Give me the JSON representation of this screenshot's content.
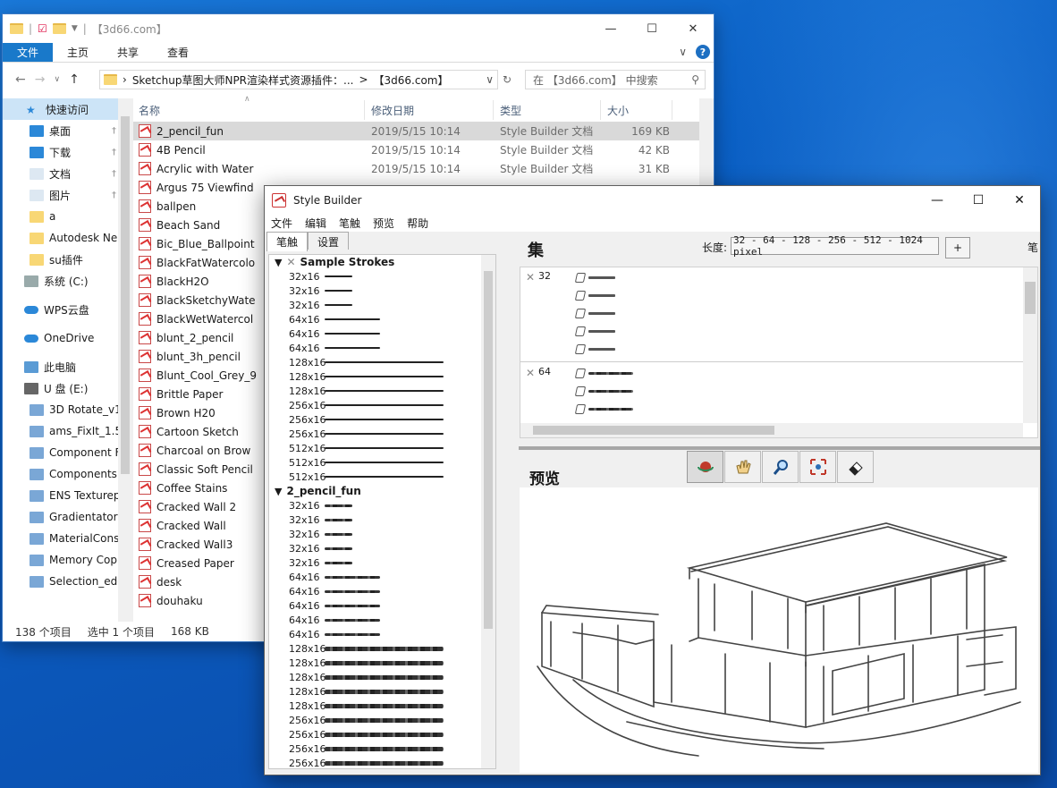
{
  "explorer": {
    "title": "【3d66.com】",
    "ribbon_tabs": [
      "文件",
      "主页",
      "共享",
      "查看"
    ],
    "address": {
      "path1": "Sketchup草图大师NPR渲染样式资源插件：...",
      "sep": ">",
      "path2": "【3d66.com】"
    },
    "search_placeholder": "在 【3d66.com】 中搜索",
    "nav": [
      {
        "label": "快速访问",
        "icon": "star-icon"
      },
      {
        "label": "桌面",
        "icon": "desktop-icon",
        "pinned": true
      },
      {
        "label": "下载",
        "icon": "download-icon",
        "pinned": true
      },
      {
        "label": "文档",
        "icon": "document-icon",
        "pinned": true
      },
      {
        "label": "图片",
        "icon": "pictures-icon",
        "pinned": true
      },
      {
        "label": "a",
        "icon": "folder-icon"
      },
      {
        "label": "Autodesk Ne",
        "icon": "folder-icon"
      },
      {
        "label": "su插件",
        "icon": "folder-icon"
      },
      {
        "label": "系统 (C:)",
        "icon": "drive-icon"
      },
      {
        "label": "WPS云盘",
        "icon": "cloud-icon"
      },
      {
        "label": "OneDrive",
        "icon": "cloud-icon"
      },
      {
        "label": "此电脑",
        "icon": "computer-icon"
      },
      {
        "label": "U 盘 (E:)",
        "icon": "usb-drive-icon"
      },
      {
        "label": "3D Rotate_v1",
        "icon": "zip-folder-icon"
      },
      {
        "label": "ams_FixIt_1.5",
        "icon": "zip-folder-icon"
      },
      {
        "label": "Component F",
        "icon": "zip-folder-icon"
      },
      {
        "label": "Components",
        "icon": "zip-folder-icon"
      },
      {
        "label": "ENS Texturep",
        "icon": "zip-folder-icon"
      },
      {
        "label": "Gradientator",
        "icon": "zip-folder-icon"
      },
      {
        "label": "MaterialCons",
        "icon": "zip-folder-icon"
      },
      {
        "label": "Memory Cop",
        "icon": "zip-folder-icon"
      },
      {
        "label": "Selection_edg",
        "icon": "zip-folder-icon"
      }
    ],
    "columns": {
      "name": "名称",
      "date": "修改日期",
      "type": "类型",
      "size": "大小"
    },
    "files": [
      {
        "name": "2_pencil_fun",
        "date": "2019/5/15 10:14",
        "type": "Style Builder 文档",
        "size": "169 KB"
      },
      {
        "name": "4B Pencil",
        "date": "2019/5/15 10:14",
        "type": "Style Builder 文档",
        "size": "42 KB"
      },
      {
        "name": "Acrylic with Water",
        "date": "2019/5/15 10:14",
        "type": "Style Builder 文档",
        "size": "31 KB"
      },
      {
        "name": "Argus 75 Viewfind"
      },
      {
        "name": "ballpen"
      },
      {
        "name": "Beach Sand"
      },
      {
        "name": "Bic_Blue_Ballpoint"
      },
      {
        "name": "BlackFatWatercolo"
      },
      {
        "name": "BlackH2O"
      },
      {
        "name": "BlackSketchyWate"
      },
      {
        "name": "BlackWetWatercol"
      },
      {
        "name": "blunt_2_pencil"
      },
      {
        "name": "blunt_3h_pencil"
      },
      {
        "name": "Blunt_Cool_Grey_9"
      },
      {
        "name": "Brittle Paper"
      },
      {
        "name": "Brown H20"
      },
      {
        "name": "Cartoon Sketch"
      },
      {
        "name": "Charcoal on Brow"
      },
      {
        "name": "Classic Soft Pencil"
      },
      {
        "name": "Coffee Stains"
      },
      {
        "name": "Cracked Wall 2"
      },
      {
        "name": "Cracked Wall"
      },
      {
        "name": "Cracked Wall3"
      },
      {
        "name": "Creased Paper"
      },
      {
        "name": "desk"
      },
      {
        "name": "douhaku"
      }
    ],
    "status": {
      "count": "138 个项目",
      "selected": "选中 1 个项目",
      "size": "168 KB"
    }
  },
  "stylebuilder": {
    "title": "Style Builder",
    "menu": [
      "文件",
      "编辑",
      "笔触",
      "预览",
      "帮助"
    ],
    "tabs": [
      "笔触",
      "设置"
    ],
    "groups": [
      {
        "name": "Sample Strokes",
        "items": [
          {
            "label": "32x16",
            "w": 31
          },
          {
            "label": "32x16",
            "w": 31
          },
          {
            "label": "32x16",
            "w": 31
          },
          {
            "label": "64x16",
            "w": 62
          },
          {
            "label": "64x16",
            "w": 62
          },
          {
            "label": "64x16",
            "w": 62
          },
          {
            "label": "128x16",
            "w": 133
          },
          {
            "label": "128x16",
            "w": 133
          },
          {
            "label": "128x16",
            "w": 133
          },
          {
            "label": "256x16",
            "w": 133
          },
          {
            "label": "256x16",
            "w": 133
          },
          {
            "label": "256x16",
            "w": 133
          },
          {
            "label": "512x16",
            "w": 133
          },
          {
            "label": "512x16",
            "w": 133
          },
          {
            "label": "512x16",
            "w": 133
          }
        ]
      },
      {
        "name": "2_pencil_fun",
        "items": [
          {
            "label": "32x16",
            "w": 31
          },
          {
            "label": "32x16",
            "w": 31
          },
          {
            "label": "32x16",
            "w": 31
          },
          {
            "label": "32x16",
            "w": 31
          },
          {
            "label": "32x16",
            "w": 31
          },
          {
            "label": "64x16",
            "w": 62
          },
          {
            "label": "64x16",
            "w": 62
          },
          {
            "label": "64x16",
            "w": 62
          },
          {
            "label": "64x16",
            "w": 62
          },
          {
            "label": "64x16",
            "w": 62
          },
          {
            "label": "128x16",
            "w": 133
          },
          {
            "label": "128x16",
            "w": 133
          },
          {
            "label": "128x16",
            "w": 133
          },
          {
            "label": "128x16",
            "w": 133
          },
          {
            "label": "128x16",
            "w": 133
          },
          {
            "label": "256x16",
            "w": 133
          },
          {
            "label": "256x16",
            "w": 133
          },
          {
            "label": "256x16",
            "w": 133
          },
          {
            "label": "256x16",
            "w": 133
          }
        ]
      }
    ],
    "set_title": "集",
    "length_label": "长度:",
    "length_value": "32 - 64 - 128 - 256 - 512 - 1024 pixel",
    "plus_label": "+",
    "cut_label": "笔",
    "set_rows": [
      {
        "size": "32"
      },
      {
        "size": "64"
      }
    ],
    "preview_title": "预览",
    "tools": [
      "orbit-icon",
      "pan-hand-icon",
      "zoom-icon",
      "zoom-extents-icon",
      "eraser-icon"
    ]
  }
}
